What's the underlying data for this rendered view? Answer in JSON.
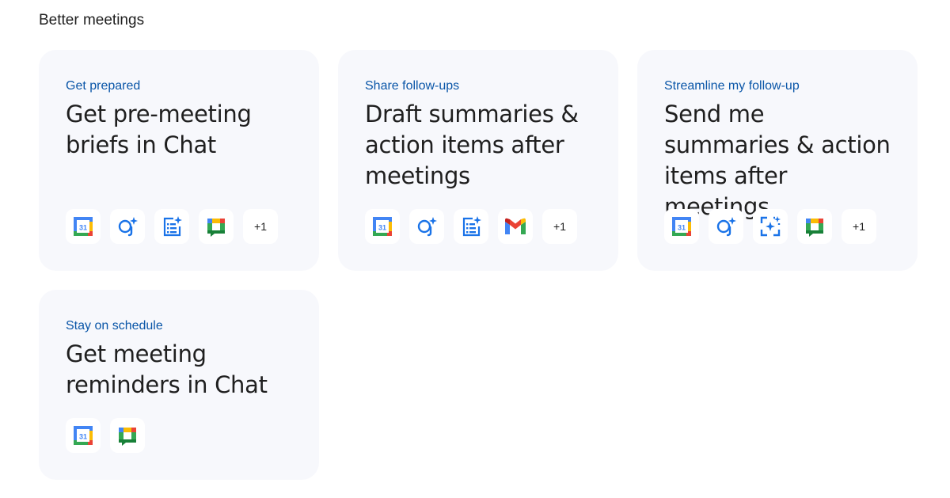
{
  "section": {
    "title": "Better meetings"
  },
  "cards": [
    {
      "eyebrow": "Get prepared",
      "title": "Get pre-meeting briefs in Chat",
      "icons": [
        "calendar-icon",
        "assistant-sparkle-icon",
        "tasks-sparkle-icon",
        "chat-icon"
      ],
      "more_label": "+1"
    },
    {
      "eyebrow": "Share follow-ups",
      "title": "Draft summaries & action items after meetings",
      "icons": [
        "calendar-icon",
        "assistant-sparkle-icon",
        "tasks-sparkle-icon",
        "gmail-icon"
      ],
      "more_label": "+1"
    },
    {
      "eyebrow": "Streamline my follow-up",
      "title": "Send me summaries & action items after meetings",
      "icons": [
        "calendar-icon",
        "assistant-sparkle-icon",
        "focus-sparkle-icon",
        "chat-icon"
      ],
      "more_label": "+1"
    },
    {
      "eyebrow": "Stay on schedule",
      "title": "Get meeting reminders in Chat",
      "icons": [
        "calendar-icon",
        "chat-icon"
      ]
    }
  ],
  "calendar_day": "31",
  "colors": {
    "eyebrow": "#0a56a8",
    "card_bg": "#f7f8fc",
    "google_blue": "#4285f4",
    "google_red": "#ea4335",
    "google_yellow": "#fbbc04",
    "google_green": "#34a853"
  }
}
